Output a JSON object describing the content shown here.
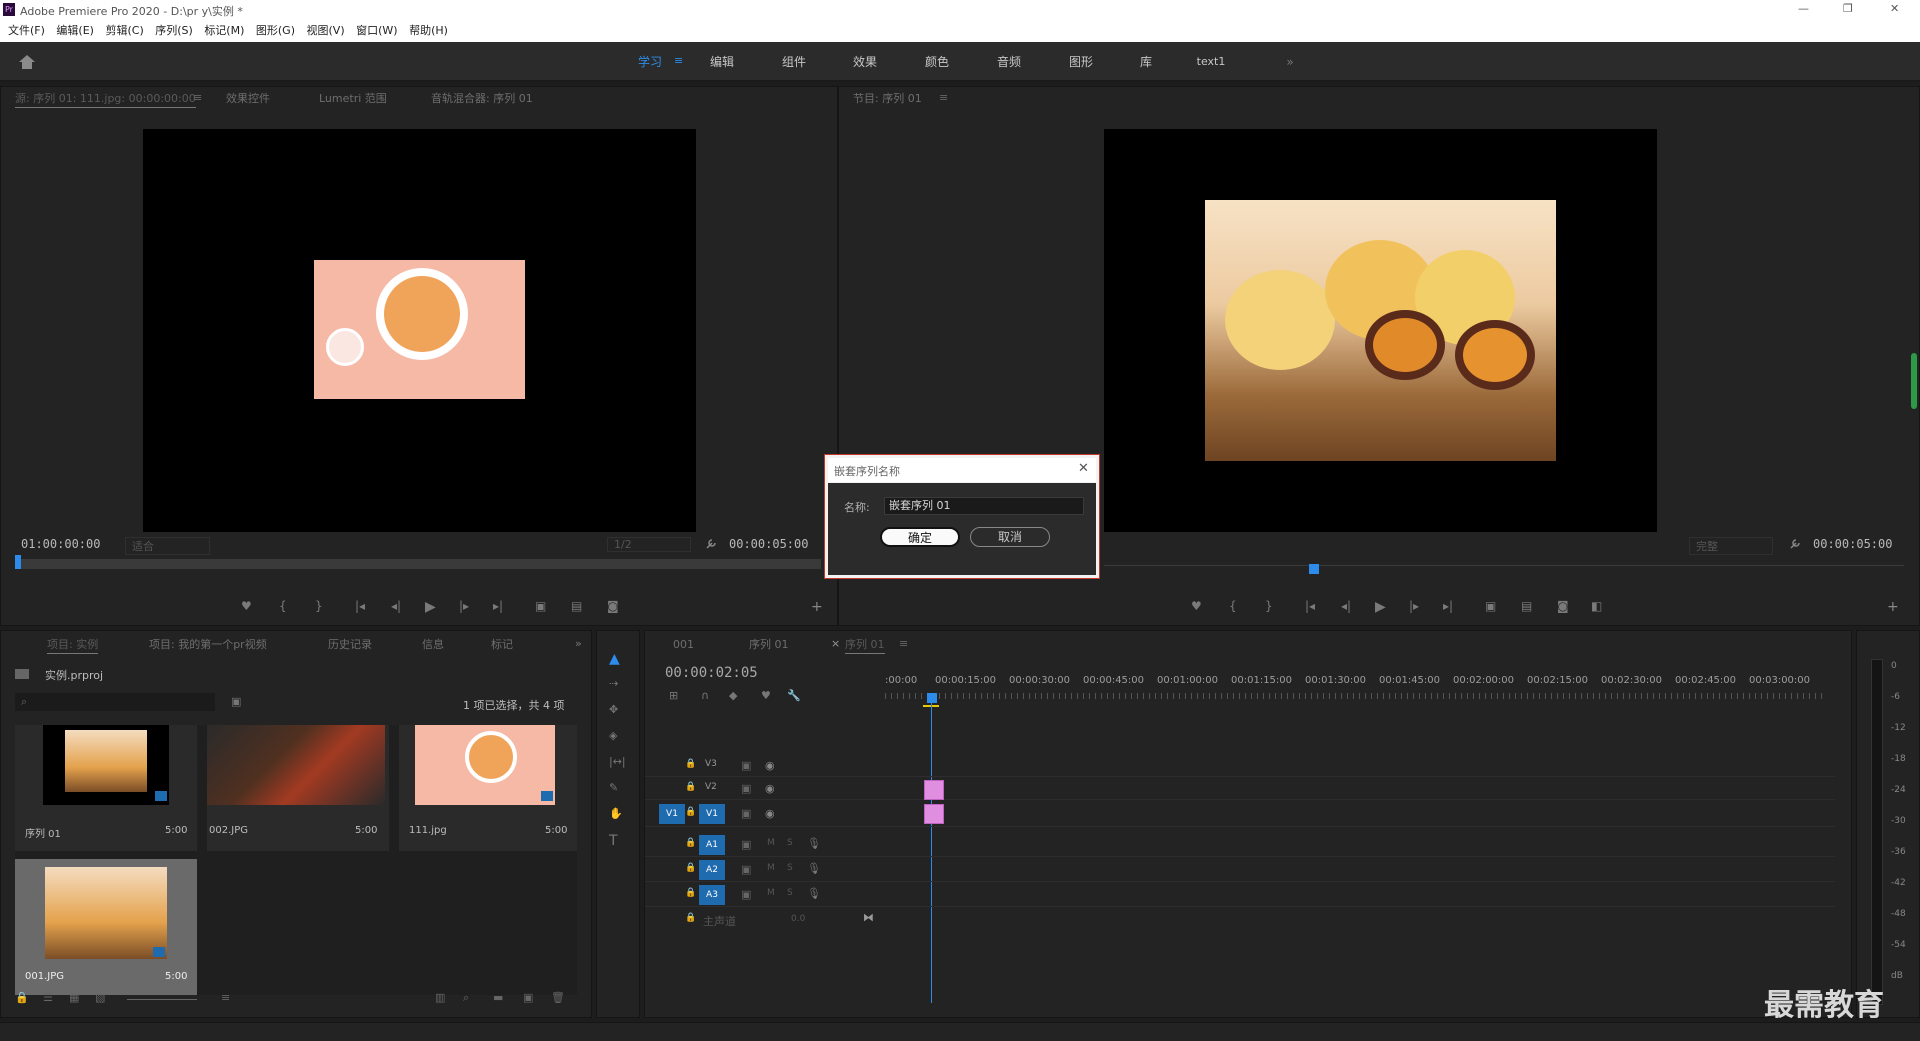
{
  "app": {
    "title": "Adobe Premiere Pro 2020 - D:\\pr y\\实例 *",
    "logo": "Pr"
  },
  "window": {
    "minimize": "—",
    "restore": "❐",
    "close": "✕"
  },
  "menu": [
    "文件(F)",
    "编辑(E)",
    "剪辑(C)",
    "序列(S)",
    "标记(M)",
    "图形(G)",
    "视图(V)",
    "窗口(W)",
    "帮助(H)"
  ],
  "workspaces": [
    "学习",
    "编辑",
    "组件",
    "效果",
    "颜色",
    "音频",
    "图形",
    "库",
    "text1"
  ],
  "workspace_more": "»",
  "source": {
    "tabs": [
      "源: 序列 01: 111.jpg: 00:00:00:00",
      "效果控件",
      "Lumetri 范围",
      "音轨混合器: 序列 01"
    ],
    "timecode_in": "01:00:00:00",
    "timecode_out": "00:00:05:00",
    "fit": "适合",
    "resolution": "1/2"
  },
  "program": {
    "tab": "节目: 序列 01",
    "timecode_out": "00:00:05:00",
    "quality": "完整"
  },
  "project": {
    "tabs": [
      "项目: 实例",
      "项目: 我的第一个pr视频",
      "历史记录",
      "信息",
      "标记"
    ],
    "file": "实例.prproj",
    "search_placeholder": "",
    "status": "1 项已选择，共 4 项",
    "items": [
      {
        "name": "序列 01",
        "duration": "5:00"
      },
      {
        "name": "002.JPG",
        "duration": "5:00"
      },
      {
        "name": "111.jpg",
        "duration": "5:00"
      },
      {
        "name": "001.JPG",
        "duration": "5:00"
      }
    ]
  },
  "timeline": {
    "tabs": [
      "001",
      "序列 01",
      "序列 01"
    ],
    "timecode": "00:00:02:05",
    "ruler": [
      ":00:00",
      "00:00:15:00",
      "00:00:30:00",
      "00:00:45:00",
      "00:01:00:00",
      "00:01:15:00",
      "00:01:30:00",
      "00:01:45:00",
      "00:02:00:00",
      "00:02:15:00",
      "00:02:30:00",
      "00:02:45:00",
      "00:03:00:00"
    ],
    "video_tracks": [
      "V3",
      "V2",
      "V1"
    ],
    "audio_tracks": [
      "A1",
      "A2",
      "A3"
    ],
    "src_patch": "V1",
    "master": "主声道",
    "master_val": "0.0",
    "m": "M",
    "s": "S"
  },
  "meter": {
    "labels": [
      "0",
      "-6",
      "-12",
      "-18",
      "-24",
      "-30",
      "-36",
      "-42",
      "-48",
      "-54",
      "dB"
    ]
  },
  "dialog": {
    "title": "嵌套序列名称",
    "name_label": "名称:",
    "name_value": "嵌套序列 01",
    "ok": "确定",
    "cancel": "取消"
  },
  "watermark": "最需教育",
  "colors": {
    "accent": "#2d8ceb",
    "clip": "#e08ee0",
    "border_red": "#c0392b"
  }
}
